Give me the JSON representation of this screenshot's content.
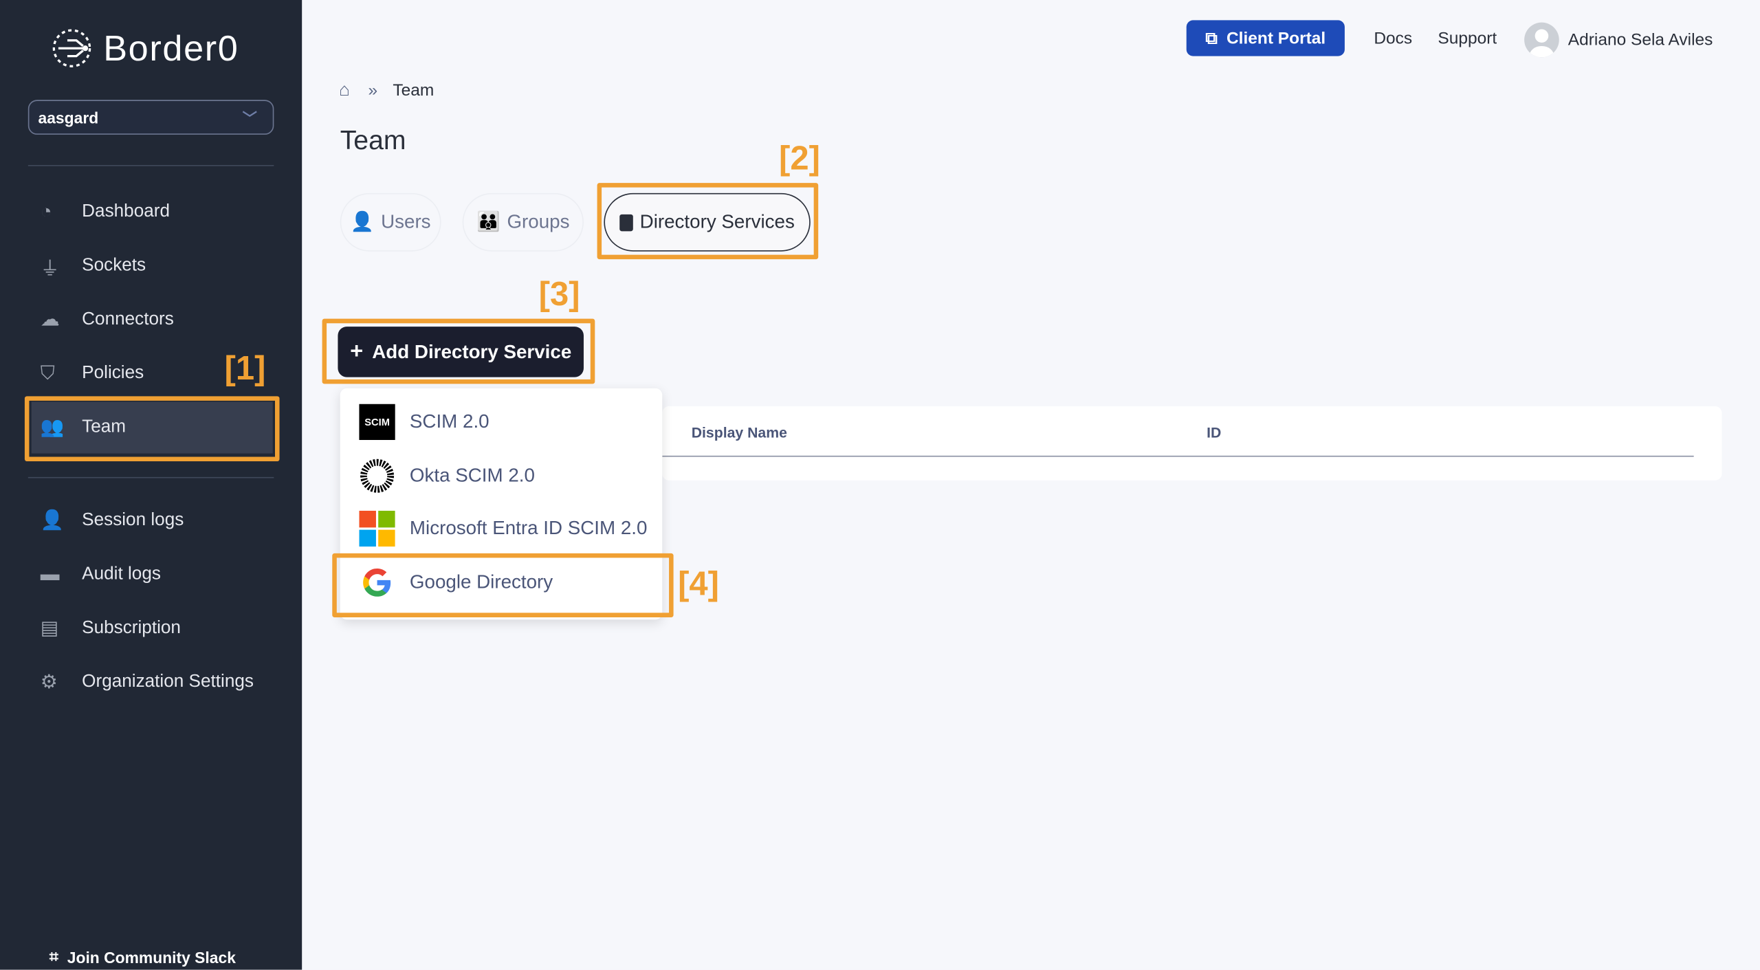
{
  "brand": {
    "name": "Border0"
  },
  "sidebar": {
    "org_select": {
      "value": "aasgard"
    },
    "items": [
      {
        "label": "Dashboard",
        "icon": "pie-chart-icon"
      },
      {
        "label": "Sockets",
        "icon": "plug-icon"
      },
      {
        "label": "Connectors",
        "icon": "cloud-upload-icon"
      },
      {
        "label": "Policies",
        "icon": "shield-icon"
      },
      {
        "label": "Team",
        "icon": "users-icon",
        "active": true
      }
    ],
    "items2": [
      {
        "label": "Session logs",
        "icon": "user-clock-icon"
      },
      {
        "label": "Audit logs",
        "icon": "wallet-icon"
      },
      {
        "label": "Subscription",
        "icon": "id-card-icon"
      },
      {
        "label": "Organization Settings",
        "icon": "gear-icon"
      }
    ],
    "footer": {
      "label": "Join Community Slack",
      "icon": "slack-icon"
    }
  },
  "header": {
    "client_portal": "Client Portal",
    "docs": "Docs",
    "support": "Support",
    "user_name": "Adriano Sela Aviles"
  },
  "breadcrumb": {
    "current": "Team"
  },
  "page": {
    "title": "Team"
  },
  "tabs": [
    {
      "label": "Users"
    },
    {
      "label": "Groups"
    },
    {
      "label": "Directory Services",
      "active": true
    }
  ],
  "add_button": {
    "label": "Add Directory Service"
  },
  "dropdown": {
    "items": [
      {
        "label": "SCIM 2.0",
        "icon": "scim-logo-icon",
        "logo_text": "SCIM"
      },
      {
        "label": "Okta SCIM 2.0",
        "icon": "okta-logo-icon"
      },
      {
        "label": "Microsoft Entra ID SCIM 2.0",
        "icon": "microsoft-logo-icon"
      },
      {
        "label": "Google Directory",
        "icon": "google-logo-icon"
      }
    ]
  },
  "table": {
    "columns": [
      "Display Name",
      "ID"
    ]
  },
  "annotations": [
    "[1]",
    "[2]",
    "[3]",
    "[4]"
  ],
  "colors": {
    "sidebar": "#212835",
    "accent": "#1e4bb8",
    "annotation": "#f0a033",
    "button_dark": "#1b1e2e"
  }
}
